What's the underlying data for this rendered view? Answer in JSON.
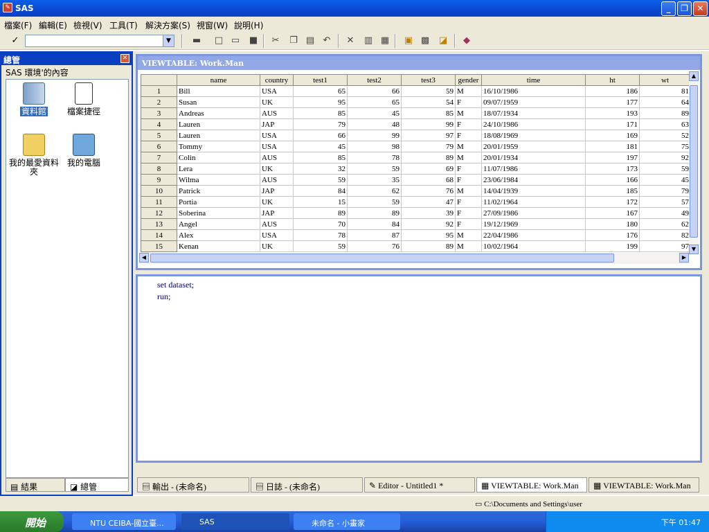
{
  "window": {
    "title": "SAS",
    "minimize": "_",
    "restore": "❐",
    "close": "✕"
  },
  "menu": [
    "檔案(F)",
    "編輯(E)",
    "檢視(V)",
    "工具(T)",
    "解決方案(S)",
    "視窗(W)",
    "說明(H)"
  ],
  "toolbar": {
    "check": "✓",
    "command_value": ""
  },
  "explorer": {
    "title": "總管",
    "subtitle": "SAS 環境'的內容",
    "items": [
      "資料館",
      "檔案捷徑",
      "我的最愛資料夾",
      "我的電腦"
    ],
    "tabs": [
      "結果",
      "總管"
    ]
  },
  "viewtable": {
    "title": "VIEWTABLE: Work.Man",
    "columns": [
      "name",
      "country",
      "test1",
      "test2",
      "test3",
      "gender",
      "time",
      "ht",
      "wt"
    ],
    "rows": [
      [
        "1",
        "Bill",
        "USA",
        "65",
        "66",
        "59",
        "M",
        "16/10/1986",
        "186",
        "81"
      ],
      [
        "2",
        "Susan",
        "UK",
        "95",
        "65",
        "54",
        "F",
        "09/07/1959",
        "177",
        "64"
      ],
      [
        "3",
        "Andreas",
        "AUS",
        "85",
        "45",
        "85",
        "M",
        "18/07/1934",
        "193",
        "89"
      ],
      [
        "4",
        "Lauren",
        "JAP",
        "79",
        "48",
        "99",
        "F",
        "24/10/1986",
        "171",
        "63"
      ],
      [
        "5",
        "Lauren",
        "USA",
        "66",
        "99",
        "97",
        "F",
        "18/08/1969",
        "169",
        "52"
      ],
      [
        "6",
        "Tommy",
        "USA",
        "45",
        "98",
        "79",
        "M",
        "20/01/1959",
        "181",
        "75"
      ],
      [
        "7",
        "Colin",
        "AUS",
        "85",
        "78",
        "89",
        "M",
        "20/01/1934",
        "197",
        "92"
      ],
      [
        "8",
        "Lera",
        "UK",
        "32",
        "59",
        "69",
        "F",
        "11/07/1986",
        "173",
        "59"
      ],
      [
        "9",
        "Wilma",
        "AUS",
        "59",
        "35",
        "68",
        "F",
        "23/06/1984",
        "166",
        "45"
      ],
      [
        "10",
        "Patrick",
        "JAP",
        "84",
        "62",
        "76",
        "M",
        "14/04/1939",
        "185",
        "79"
      ],
      [
        "11",
        "Portia",
        "UK",
        "15",
        "59",
        "47",
        "F",
        "11/02/1964",
        "172",
        "57"
      ],
      [
        "12",
        "Soberina",
        "JAP",
        "89",
        "89",
        "39",
        "F",
        "27/09/1986",
        "167",
        "49"
      ],
      [
        "13",
        "Angel",
        "AUS",
        "70",
        "84",
        "92",
        "F",
        "19/12/1969",
        "180",
        "62"
      ],
      [
        "14",
        "Alex",
        "USA",
        "78",
        "87",
        "95",
        "M",
        "22/04/1986",
        "176",
        "82"
      ],
      [
        "15",
        "Kenan",
        "UK",
        "59",
        "76",
        "89",
        "M",
        "10/02/1964",
        "199",
        "97"
      ]
    ]
  },
  "editor": {
    "lines": [
      "set dataset;",
      "run;"
    ]
  },
  "window_tabs": [
    "輸出 - (未命名)",
    "日誌 - (未命名)",
    "Editor - Untitled1 *",
    "VIEWTABLE: Work.Man",
    "VIEWTABLE: Work.Man"
  ],
  "status": {
    "path": "C:\\Documents and Settings\\user"
  },
  "taskbar": {
    "start": "開始",
    "tasks": [
      "NTU CEIBA-國立臺...",
      "SAS",
      "未命名 - 小畫家"
    ],
    "clock": "下午 01:47"
  }
}
